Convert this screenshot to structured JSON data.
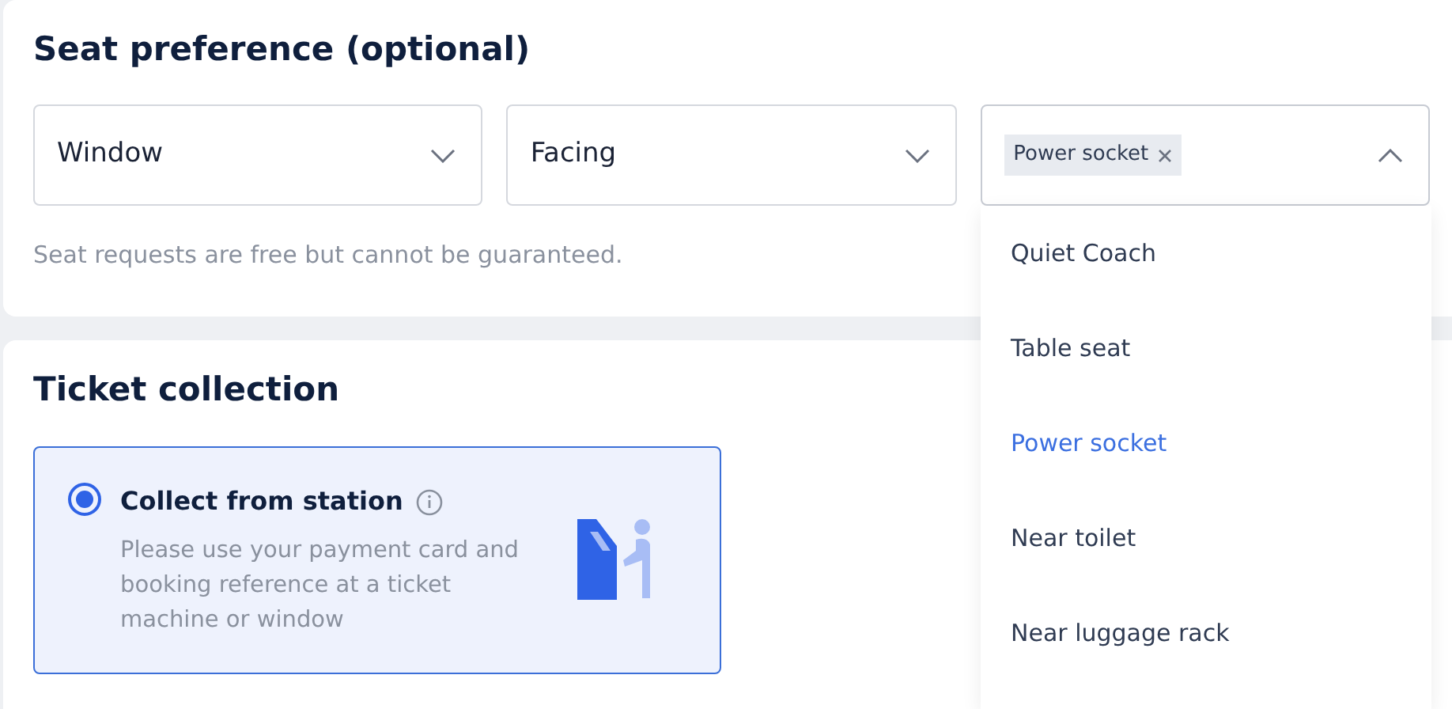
{
  "seat_preference": {
    "title": "Seat preference (optional)",
    "selects": [
      {
        "value": "Window",
        "expanded": false
      },
      {
        "value": "Facing",
        "expanded": false
      },
      {
        "tags": [
          "Power socket"
        ],
        "expanded": true
      }
    ],
    "hint": "Seat requests are free but cannot be guaranteed.",
    "dropdown_options": [
      {
        "label": "Quiet Coach",
        "selected": false
      },
      {
        "label": "Table seat",
        "selected": false
      },
      {
        "label": "Power socket",
        "selected": true
      },
      {
        "label": "Near toilet",
        "selected": false
      },
      {
        "label": "Near luggage rack",
        "selected": false
      }
    ]
  },
  "ticket_collection": {
    "title": "Ticket collection",
    "options": [
      {
        "label": "Collect from station",
        "selected": true,
        "description": "Please use your payment card and booking reference at a ticket machine or window"
      }
    ]
  }
}
